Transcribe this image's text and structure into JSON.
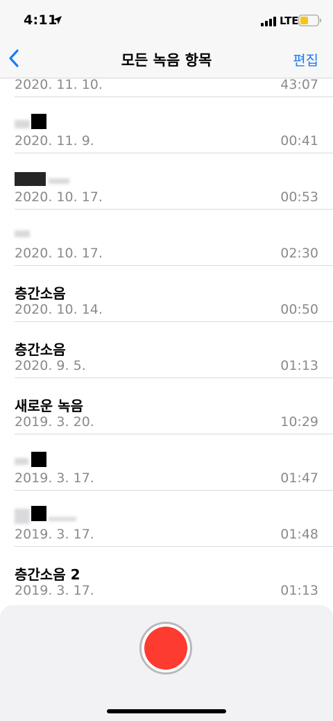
{
  "status": {
    "time": "4:11",
    "network": "LTE"
  },
  "nav": {
    "title": "모든 녹음 항목",
    "edit": "편집"
  },
  "recordings": [
    {
      "title": "",
      "date": "2020. 11. 10.",
      "duration": "43:07"
    },
    {
      "title": "",
      "date": "2020. 11. 9.",
      "duration": "00:41"
    },
    {
      "title": "",
      "date": "2020. 10. 17.",
      "duration": "00:53"
    },
    {
      "title": "",
      "date": "2020. 10. 17.",
      "duration": "02:30"
    },
    {
      "title": "층간소음",
      "date": "2020. 10. 14.",
      "duration": "00:50"
    },
    {
      "title": "층간소음",
      "date": "2020. 9. 5.",
      "duration": "01:13"
    },
    {
      "title": "새로운 녹음",
      "date": "2019. 3. 20.",
      "duration": "10:29"
    },
    {
      "title": "",
      "date": "2019. 3. 17.",
      "duration": "01:47"
    },
    {
      "title": "",
      "date": "2019. 3. 17.",
      "duration": "01:48"
    },
    {
      "title": "층간소음 2",
      "date": "2019. 3. 17.",
      "duration": "01:13"
    }
  ],
  "icons": {
    "back": "chevron-left-icon",
    "location": "location-arrow-icon",
    "signal": "cellular-signal-icon",
    "battery": "battery-low-icon",
    "record": "record-icon"
  },
  "colors": {
    "accent": "#1a7cf5",
    "record": "#fe3b30",
    "battery": "#f5c518",
    "secondary_text": "#8a8a8e"
  }
}
